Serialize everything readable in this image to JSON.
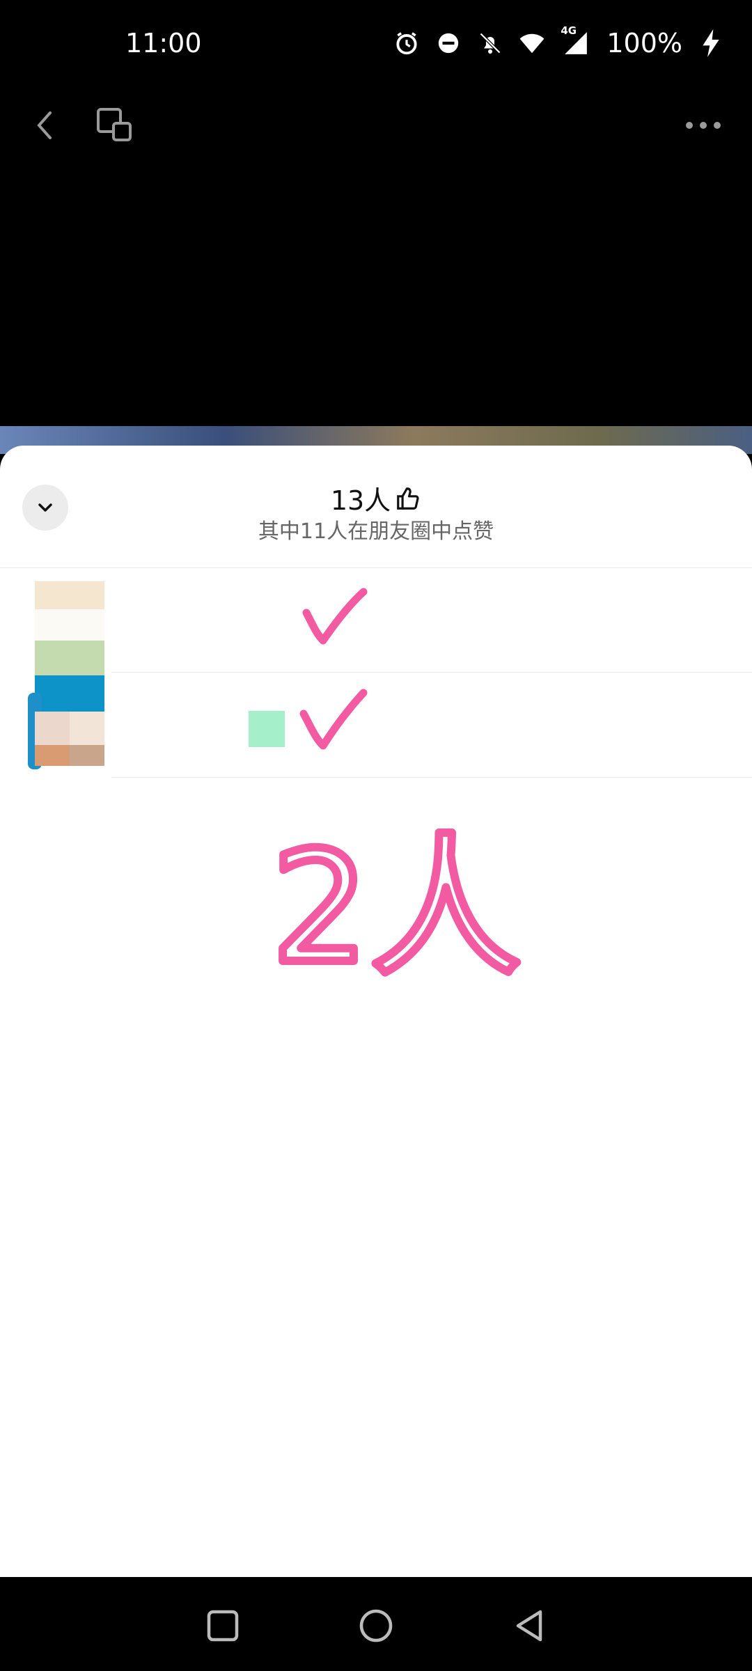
{
  "status_bar": {
    "time": "11:00",
    "network": "4G",
    "battery": "100%",
    "icons": [
      "alarm-icon",
      "do-not-disturb-icon",
      "bell-off-icon",
      "wifi-icon",
      "signal-icon",
      "charging-icon"
    ]
  },
  "top_bar": {
    "icons": [
      "back-icon",
      "floating-window-icon",
      "more-icon"
    ]
  },
  "sheet": {
    "title": "13人",
    "subtitle": "其中11人在朋友圈中点赞"
  },
  "annotation": {
    "text": "2人",
    "color": "#f25aa2"
  },
  "nav_bar": {
    "icons": [
      "recents-icon",
      "home-icon",
      "back-triangle-icon"
    ]
  }
}
